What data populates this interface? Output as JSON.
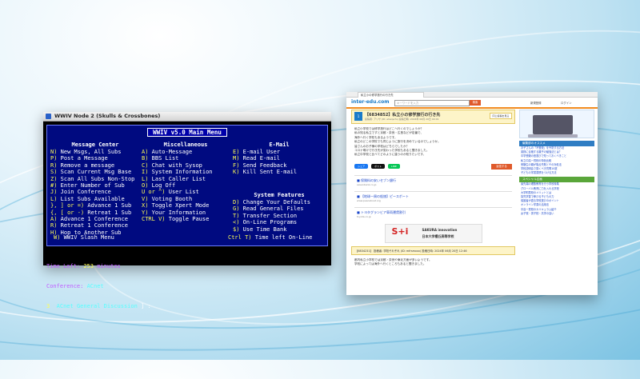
{
  "terminal": {
    "window_title": "WWIV Node 2 (Skulls & Crossbones)",
    "menu_title": "WWIV v5.0  Main Menu",
    "columns": [
      {
        "heading": "Message Center",
        "lines": [
          {
            "key": "N)",
            "text": " New Msgs, All Subs"
          },
          {
            "key": "P)",
            "text": " Post a Message"
          },
          {
            "key": "R)",
            "text": " Remove a message"
          },
          {
            "key": "S)",
            "text": " Scan Current Msg Base"
          },
          {
            "key": "Z)",
            "text": " Scan All Subs Non-Stop"
          },
          {
            "key": "#)",
            "text": " Enter Number of Sub"
          },
          {
            "key": "J)",
            "text": " Join Conference"
          },
          {
            "key": "L)",
            "text": " List Subs Available"
          },
          {
            "key": "}, ] or =)",
            "text": " Advance 1 Sub"
          },
          {
            "key": "{, [ or -)",
            "text": " Retreat 1 Sub"
          },
          {
            "key": "A)",
            "text": " Advance 1 Conference"
          },
          {
            "key": "R)",
            "text": " Retreat 1 Conference"
          },
          {
            "key": "H)",
            "text": " Hop to Another Sub"
          }
        ]
      },
      {
        "heading": "Miscellaneous",
        "lines": [
          {
            "key": "A)",
            "text": " Auto-Message"
          },
          {
            "key": "B)",
            "text": " BBS List"
          },
          {
            "key": "C)",
            "text": " Chat with Sysop"
          },
          {
            "key": "I)",
            "text": " System Information"
          },
          {
            "key": "L)",
            "text": " Last Caller List"
          },
          {
            "key": "O)",
            "text": " Log Off"
          },
          {
            "key": "U or ^)",
            "text": " User List"
          },
          {
            "key": "V)",
            "text": " Voting Booth"
          },
          {
            "key": "X)",
            "text": " Toggle Xpert Mode"
          },
          {
            "key": "Y)",
            "text": " Your Information"
          },
          {
            "key": "CTRL V)",
            "text": " Toggle Pause"
          }
        ]
      },
      {
        "heading": "E-Mail",
        "lines": [
          {
            "key": "E)",
            "text": " E-mail User"
          },
          {
            "key": "M)",
            "text": " Read E-mail"
          },
          {
            "key": "F)",
            "text": " Send Feedback"
          },
          {
            "key": "K)",
            "text": " Kill Sent E-mail"
          }
        ]
      }
    ],
    "system_features": {
      "heading": "System Features",
      "lines": [
        {
          "key": "D)",
          "text": " Change Your Defaults"
        },
        {
          "key": "G)",
          "text": " Read General Files"
        },
        {
          "key": "T)",
          "text": " Transfer Section"
        },
        {
          "key": "<)",
          "text": " On-Line Programs"
        },
        {
          "key": "$)",
          "text": " Use Time Bank"
        }
      ]
    },
    "slash_menu": {
      "key": "W)",
      "text": " WWIV Slash Menu"
    },
    "time_left": {
      "key": "Ctrl T)",
      "text": " Time left On-Line"
    },
    "status": {
      "time_label": "Time Left:",
      "time_value": "253",
      "time_unit": "minutes",
      "conference_label": "Conference:",
      "conference_value": "ACnet",
      "sub_number": "3",
      "sub_name": "ACnet General Discussion",
      "prompt": "] :"
    }
  },
  "browser": {
    "tab_title": "私立小の修学旅行の行き先",
    "logo": "inter-edu.com",
    "search_placeholder": "キーワードを入力",
    "search_button": "検索",
    "header_links": [
      "新規登録",
      "ログイン"
    ],
    "question": {
      "number": "1",
      "id_title": "【6834852】私立小の修学旅行の行き先",
      "meta": "投稿者: アリサ (ID: ehwqe7s) 投稿日時: 2024年 06月 20日 00:01",
      "button": "同じ投稿を見る",
      "body": [
        "私立小学校では修学旅行はどこへ行くのでしょうか？",
        "私の知る私立ですと京都・奈良・広島などが定番で、",
        "海外へ行く学校もあるようです。",
        "私立のどこの学校でも同じように旅行を決めているのでしょうか。",
        "皆さんのお子様の学校はどちらでしたか？",
        "コロナ明けで行き先が変わった学校もあると聞きました。",
        "私立中学校と比べてどのように違うのか知りたいです。"
      ],
      "share_labels": [
        "シェア",
        "ポスト",
        "LINE"
      ],
      "answer_button": "返信する"
    },
    "ads": [
      {
        "headline": "■ 保険料の安いセブン銀行",
        "sub": "sevenbank.co.jp"
      },
      {
        "headline": "■ 【地球一周の船旅】ピースボート",
        "sub": "www.peaceboat.org"
      },
      {
        "headline": "■ トヨタグランビア車両運賃割引",
        "sub": "toyota.co.jp"
      }
    ],
    "banner": {
      "big": "S+i",
      "line1": "SAKURA innovation",
      "line2": "日本大学櫻丘高等学校"
    },
    "reply": {
      "title": "【6834231】 投稿者: 学校それぞれ (ID: mfrsmxxx) 投稿日時: 2024年 06月 20日 12:46"
    },
    "reply_body": [
      "都内私立小学校では京都・奈良や東北方面が多いようです。",
      "学校によっては海外へ行くところもあると聞きました。"
    ],
    "sidebar": {
      "section1": "編集部のオススメ",
      "links1": [
        "お子さんの「不登校」を予防する方法",
        "英検に合格する親子の勉強法とは？",
        "中学受験の塾選びで知っておくべきこと",
        "私立中高一貫校の特色比較",
        "受験生の親が陥る失敗とその対処法",
        "学校説明会で聞くべき質問10選",
        "子どもの学習習慣をつける方法"
      ],
      "section2": "スペシャル企画",
      "links2": [
        "最先端の理数教育を行う学校特集",
        "グローバル教育に力を入れる学校",
        "大学附属校のメリットとは",
        "探究学習で伸びる子どもの力",
        "保護者が語る学校選びのポイント",
        "オンライン学習の活用法",
        "中高一貫校のカリキュラム紹介",
        "女子校・男子校・共学の違い"
      ]
    }
  }
}
